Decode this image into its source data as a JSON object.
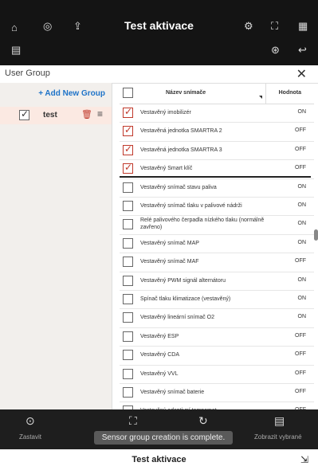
{
  "topbar": {
    "title": "Test aktivace",
    "icons": [
      "home-icon",
      "gauge-icon",
      "upload-icon",
      "settings-icon",
      "fullscreen-icon",
      "grid-icon",
      "diagnostic-icon",
      "exit-icon"
    ]
  },
  "dialog": {
    "title": "User Group",
    "close": "✕"
  },
  "left": {
    "add_label": "+ Add New Group",
    "group": {
      "name": "test",
      "checked": true
    }
  },
  "table": {
    "headers": {
      "name": "Název snímače",
      "value": "Hodnota"
    },
    "rows": [
      {
        "name": "Vestavěný imobilizér",
        "value": "ON",
        "checked": true
      },
      {
        "name": "Vestavěná jednotka SMARTRA 2",
        "value": "OFF",
        "checked": true
      },
      {
        "name": "Vestavěná jednotka SMARTRA 3",
        "value": "OFF",
        "checked": true
      },
      {
        "name": "Vestavěný Smart klíč",
        "value": "OFF",
        "checked": true
      },
      {
        "name": "Vestavěný snímač stavu paliva",
        "value": "ON",
        "checked": false
      },
      {
        "name": "Vestavěný snímač tlaku v palivové nádrži",
        "value": "ON",
        "checked": false
      },
      {
        "name": "Relé palivového čerpadla nízkého tlaku (normálně zavřeno)",
        "value": "ON",
        "checked": false
      },
      {
        "name": "Vestavěný snímač MAP",
        "value": "ON",
        "checked": false
      },
      {
        "name": "Vestavěný snímač MAF",
        "value": "OFF",
        "checked": false
      },
      {
        "name": "Vestavěný PWM signál alternátoru",
        "value": "ON",
        "checked": false
      },
      {
        "name": "Spínač tlaku klimatizace (vestavěný)",
        "value": "ON",
        "checked": false
      },
      {
        "name": "Vestavěný lineární snímač O2",
        "value": "ON",
        "checked": false
      },
      {
        "name": "Vestavěný ESP",
        "value": "OFF",
        "checked": false
      },
      {
        "name": "Vestavěný CDA",
        "value": "OFF",
        "checked": false
      },
      {
        "name": "Vestavěný VVL",
        "value": "OFF",
        "checked": false
      },
      {
        "name": "Vestavěný snímač baterie",
        "value": "OFF",
        "checked": false
      },
      {
        "name": "Vestavěný adaptivní tempomat",
        "value": "OFF",
        "checked": false
      }
    ]
  },
  "bottom": {
    "stop_label": "Zastavit",
    "show_selected_label": "Zobrazit vybrané"
  },
  "toast": "Sensor group creation is complete.",
  "footer": {
    "title": "Test aktivace"
  }
}
